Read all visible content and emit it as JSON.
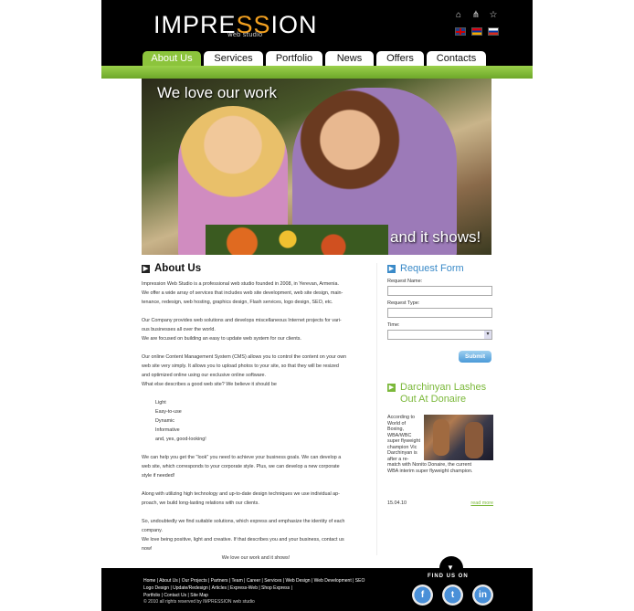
{
  "header": {
    "logo_left": "IMPRE",
    "logo_mid": "SS",
    "logo_right": "ION",
    "logo_sub": "web studio",
    "tool_icons": [
      "home-icon",
      "sitemap-icon",
      "star-icon"
    ],
    "flags": [
      "uk-flag",
      "armenia-flag",
      "russia-flag"
    ]
  },
  "nav": {
    "tabs": [
      {
        "label": "About Us",
        "active": true
      },
      {
        "label": "Services"
      },
      {
        "label": "Portfolio"
      },
      {
        "label": "News"
      },
      {
        "label": "Offers"
      },
      {
        "label": "Contacts"
      }
    ]
  },
  "hero": {
    "headline": "We love our work",
    "tagline": "and it shows!"
  },
  "about": {
    "title": "About Us",
    "p1_l1": "Impression Web Studio is a professional web studio founded in 2008, in Yerevan, Armenia.",
    "p1_l2": "We offer a wide array of services that includes web site development, web site design, main-",
    "p1_l3": "tenance, redesign, web hosting, graphics design, Flash services, logo design, SEO, etc.",
    "p2_l1": "Our Company provides web solutions and develops miscellaneous Internet projects for vari-",
    "p2_l2": "ous businesses all over the world.",
    "p2_l3": "We are focused on building an easy to update web system for our clients.",
    "p3_l1": "Our online Content Management System (CMS) allows you to control the content on your own",
    "p3_l2": "web site very simply. It allows you to upload photos to your site, so that they will be resized",
    "p3_l3": "and optimized online using our exclusive online software.",
    "p3_l4": "What else describes a good web site? We believe it should be",
    "list": [
      "Light",
      "Easy-to-use",
      "Dynamic",
      "Informative",
      "and, yes, good-looking!"
    ],
    "p4_l1": "We can help you get the \"look\" you need to achieve your business goals. We can develop a",
    "p4_l2": "web site, which corresponds to your corporate style. Plus, we can develop a new corporate",
    "p4_l3": "style if needed!",
    "p5_l1": "Along with utilizing high technology and up-to-date design techniques we use individual ap-",
    "p5_l2": "proach, we build long-lasting relations with our clients.",
    "p6_l1": "So, undoubtedly we find suitable solutions, which express and emphasize the identity of each",
    "p6_l2": "company.",
    "p6_l3": "We love being positive, light and creative. If that describes you and your business, contact us",
    "p6_l4": "now!",
    "closing": "We love our work and it shows!"
  },
  "request_form": {
    "title": "Request Form",
    "name_label": "Request Name:",
    "type_label": "Request Type:",
    "time_label": "Time:",
    "submit_label": "Submit"
  },
  "news": {
    "title_l1": "Darchinyan Lashes",
    "title_l2": "Out At Donaire",
    "text_l1": "According to",
    "text_l2": "World of",
    "text_l3": "Boxing,",
    "text_l4": "WBA/WBC",
    "text_l5": "super flyweight",
    "text_l6": "champion Vic",
    "text_l7": "Darchinyan is",
    "text_l8": "after a re-",
    "text_l9": "match with Nonito Donaire, the current",
    "text_l10": "WBA interim super flyweight champion.",
    "date": "15.04.10",
    "read_more": "read more"
  },
  "footer": {
    "links_l1": "Home | About Us | Our Projects | Partners | Team | Career | Services | Web Design | Web Development | SEO",
    "links_l2": "Logo Design | Update/Redesign | Articles | Express-Web | Shop Express |",
    "links_l3": "Portfolio | Contact Us | Site Map",
    "copyright": "© 2010 all rights reserved by IMPRESSION web studio",
    "find_us": "FIND US ON",
    "social": [
      "facebook-icon",
      "twitter-icon",
      "linkedin-icon"
    ]
  }
}
